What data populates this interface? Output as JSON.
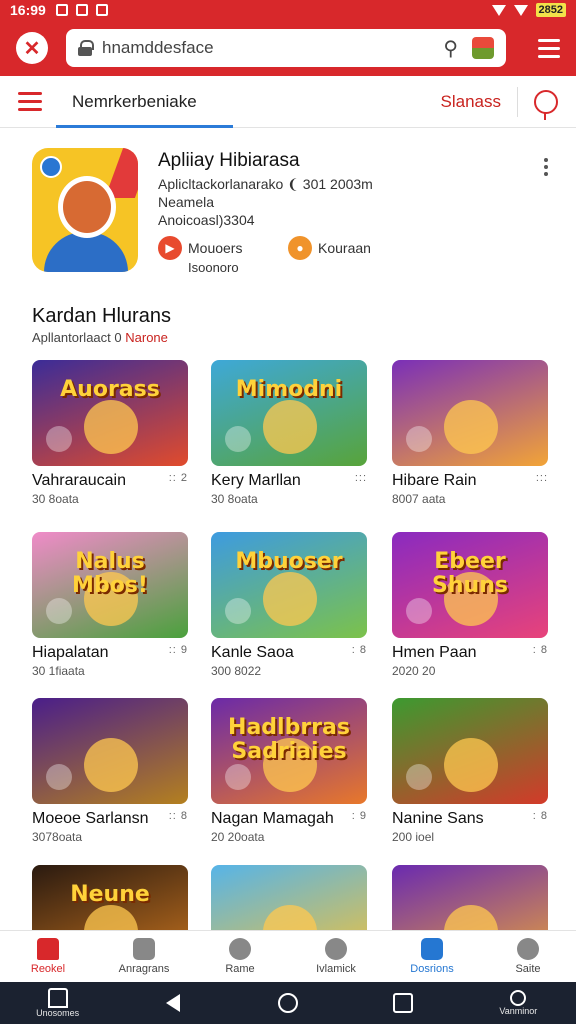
{
  "status_bar": {
    "time": "16:99",
    "battery": "2852"
  },
  "topbar": {
    "search_value": "hnamddesface"
  },
  "subbar": {
    "main_tab": "Nemrkerbeniake",
    "right_tab": "Slanass"
  },
  "app": {
    "title": "Apliiay Hibiarasa",
    "meta1": "Aplicltackorlanarako ❨ 301 2003m",
    "meta2": "Neamela",
    "meta3": "Anoicoasl)3304",
    "badge1_label": "Mouoers",
    "badge1_sub": "Isoonoro",
    "badge2_label": "Kouraan"
  },
  "section": {
    "title": "Kardan Hlurans",
    "subtitle": "Apllantorlaact 0",
    "subtitle_red": "Narone"
  },
  "games": [
    {
      "thumb_text": "Auorass",
      "name": "Vahraraucain",
      "sub": "30 8oata",
      "dots": ":: 2",
      "chip": "",
      "colors": [
        "#3b2c98",
        "#e14b2c"
      ]
    },
    {
      "thumb_text": "Mimodni",
      "name": "Kery Marllan",
      "sub": "30 8oata",
      "dots": ":::",
      "chip": "",
      "colors": [
        "#3ea8d8",
        "#58a43a"
      ]
    },
    {
      "thumb_text": "",
      "name": "Hibare Rain",
      "sub": "8007 aata",
      "dots": ":::",
      "chip": "",
      "colors": [
        "#7a2fb8",
        "#f2a437"
      ]
    },
    {
      "thumb_text": "Nalus Mbos!",
      "name": "Hiapalatan",
      "sub": "30 1fiaata",
      "dots": ":: 9",
      "chip": "",
      "colors": [
        "#f08bc9",
        "#4aa13c"
      ]
    },
    {
      "thumb_text": "Mbuoser",
      "name": "Kanle Saoa",
      "sub": "300 8022",
      "dots": ": 8",
      "chip": "",
      "colors": [
        "#3d9be0",
        "#7cc24a"
      ]
    },
    {
      "thumb_text": "Ebeer Shuns",
      "name": "Hmen Paan",
      "sub": "2020 20",
      "dots": ": 8",
      "chip": "",
      "colors": [
        "#8a2ac0",
        "#e8437a"
      ]
    },
    {
      "thumb_text": "",
      "name": "Moeoe Sarlansn",
      "sub": "3078oata",
      "dots": ":: 8",
      "chip": "",
      "colors": [
        "#4a1e8a",
        "#b4801f"
      ]
    },
    {
      "thumb_text": "Hadlbrras Sadriaies",
      "name": "Nagan Mamagah",
      "sub": "20 20oata",
      "dots": ": 9",
      "chip": "",
      "colors": [
        "#6b2aa8",
        "#e8782a"
      ]
    },
    {
      "thumb_text": "",
      "name": "Nanine Sans",
      "sub": "200 ioel",
      "dots": ": 8",
      "chip": "",
      "colors": [
        "#3c9a30",
        "#d33a2a"
      ]
    },
    {
      "thumb_text": "Neune",
      "name": "",
      "sub": "",
      "dots": "",
      "chip": "",
      "colors": [
        "#2a1a10",
        "#c8741e"
      ]
    },
    {
      "thumb_text": "",
      "name": "",
      "sub": "",
      "dots": "",
      "chip": "",
      "colors": [
        "#56b4e8",
        "#f2c23a"
      ]
    },
    {
      "thumb_text": "",
      "name": "",
      "sub": "",
      "dots": "",
      "chip": "",
      "colors": [
        "#6a2ab0",
        "#e8a23a"
      ]
    }
  ],
  "bottom_nav": [
    "Reokel",
    "Anragrans",
    "Rame",
    "Ivlamick",
    "Dosrions",
    "Saite"
  ],
  "sys_nav": {
    "left_label": "Unosomes",
    "right_label": "Vanminor"
  }
}
